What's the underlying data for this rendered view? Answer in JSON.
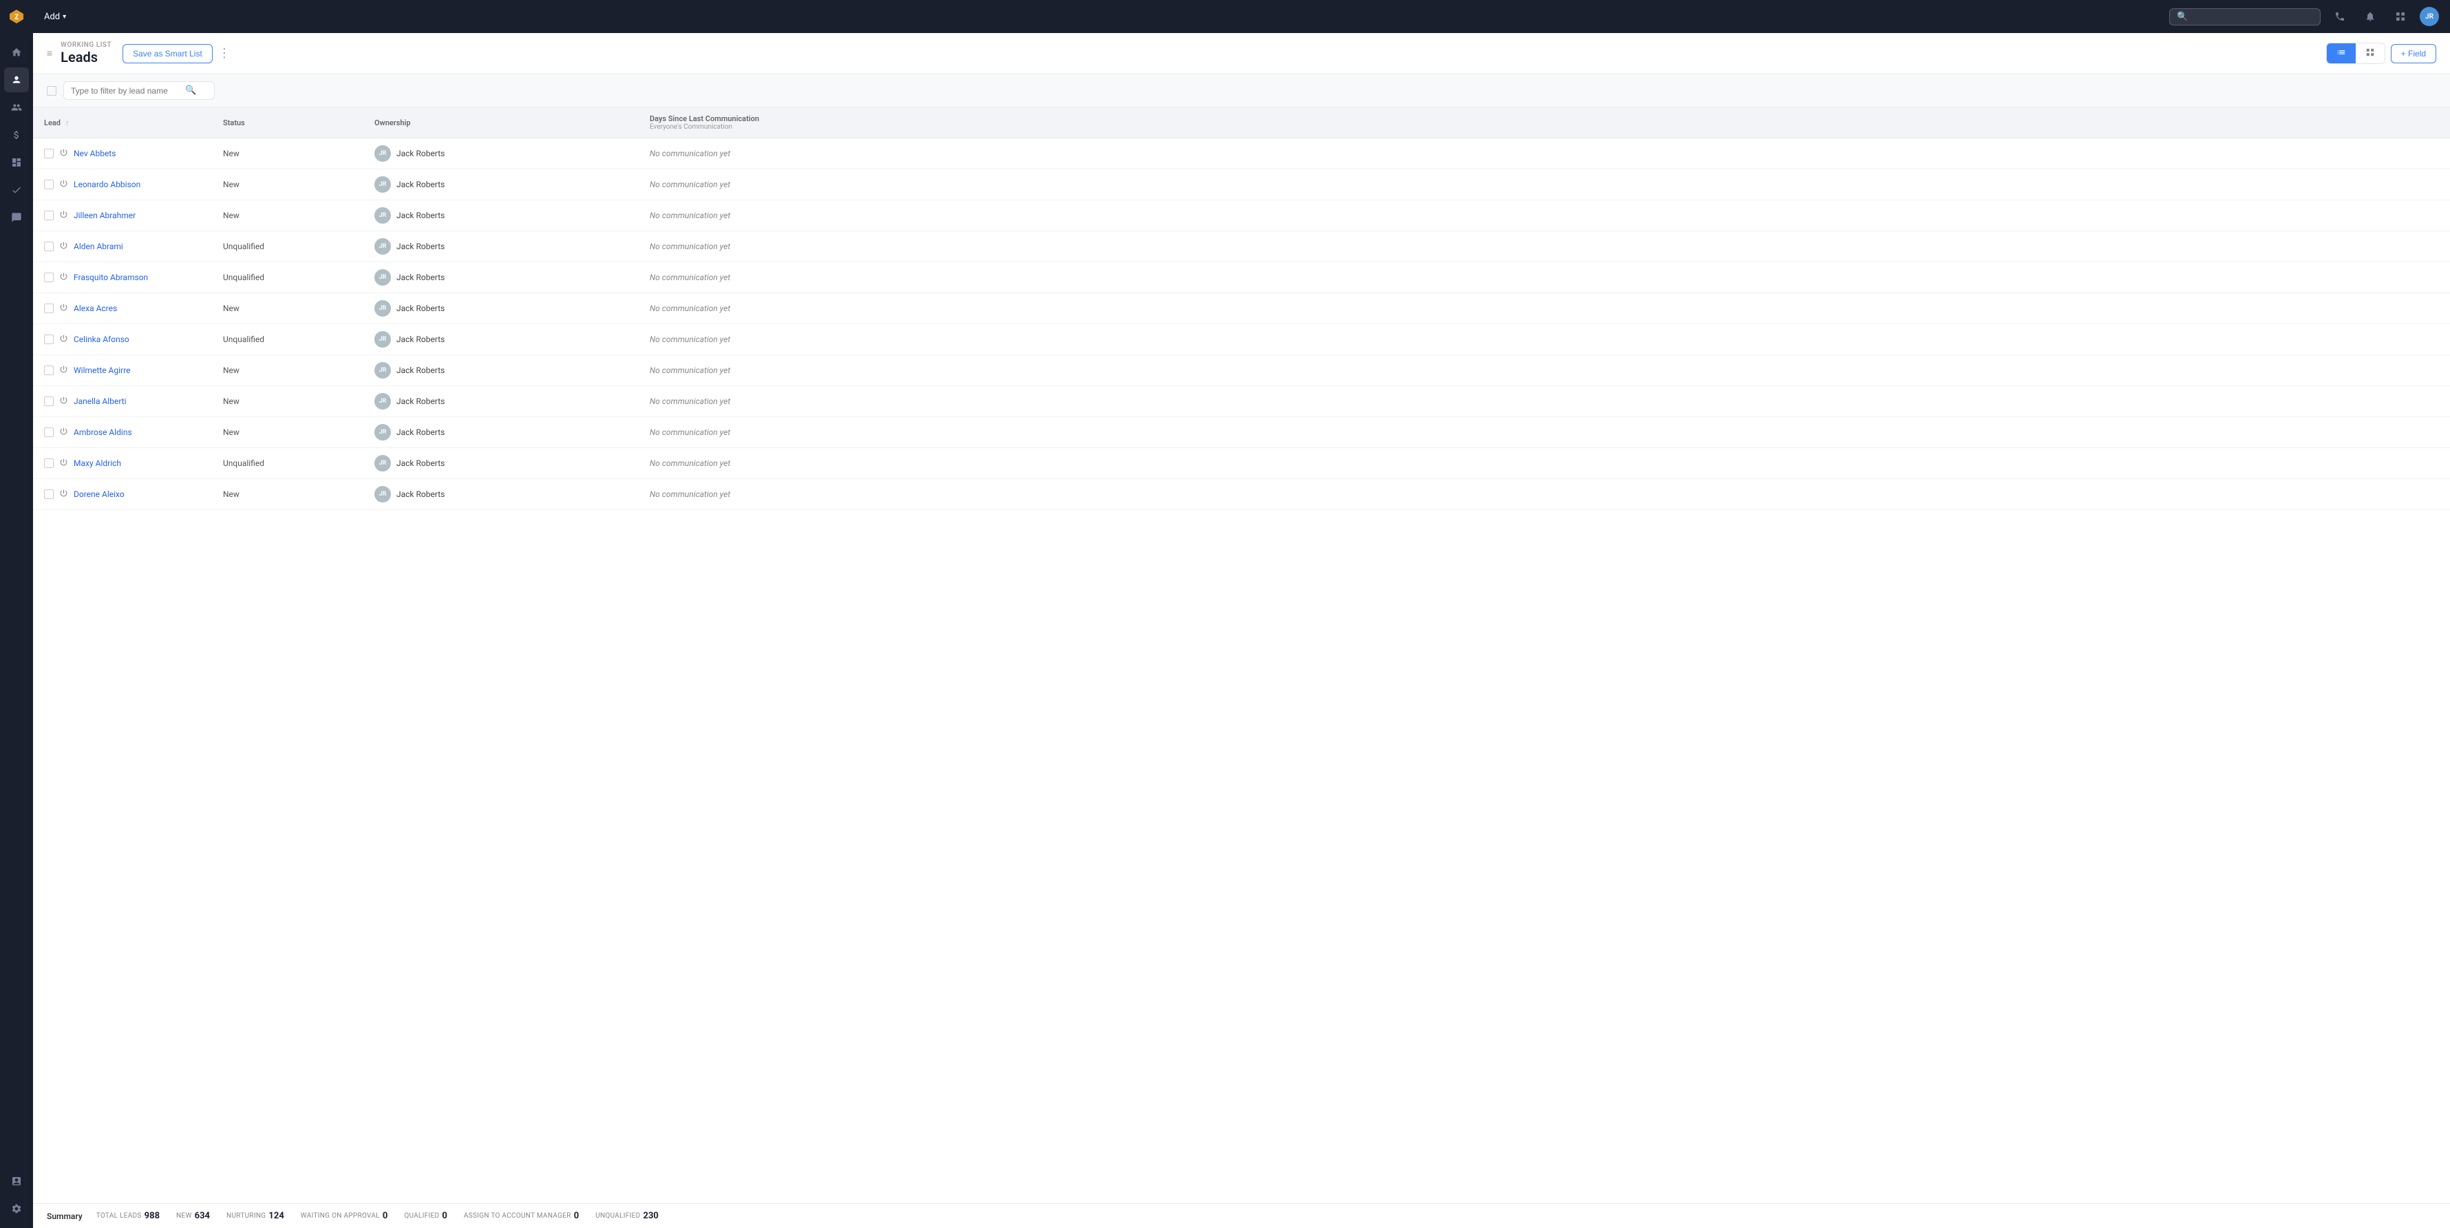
{
  "app": {
    "title": "Leads",
    "add_label": "Add",
    "logo_text": "Z"
  },
  "topbar": {
    "add_button": "Add",
    "search_placeholder": "",
    "user_initials": "JR"
  },
  "header": {
    "breadcrumb": "WORKING LIST",
    "title": "Leads",
    "save_smart_list": "Save as Smart List",
    "add_field": "+ Field"
  },
  "filter": {
    "search_placeholder": "Type to filter by lead name"
  },
  "table": {
    "columns": [
      {
        "id": "lead",
        "label": "Lead",
        "sortable": true
      },
      {
        "id": "status",
        "label": "Status",
        "sortable": false
      },
      {
        "id": "ownership",
        "label": "Ownership",
        "sortable": false
      },
      {
        "id": "comm",
        "label": "Days Since Last Communication",
        "sub": "Everyone's Communication",
        "sortable": false
      }
    ],
    "rows": [
      {
        "name": "Nev Abbets",
        "status": "New",
        "owner": "Jack Roberts",
        "owner_initials": "JR",
        "comm": "No communication yet"
      },
      {
        "name": "Leonardo Abbison",
        "status": "New",
        "owner": "Jack Roberts",
        "owner_initials": "JR",
        "comm": "No communication yet"
      },
      {
        "name": "Jilleen Abrahmer",
        "status": "New",
        "owner": "Jack Roberts",
        "owner_initials": "JR",
        "comm": "No communication yet"
      },
      {
        "name": "Alden Abrami",
        "status": "Unqualified",
        "owner": "Jack Roberts",
        "owner_initials": "JR",
        "comm": "No communication yet"
      },
      {
        "name": "Frasquito Abramson",
        "status": "Unqualified",
        "owner": "Jack Roberts",
        "owner_initials": "JR",
        "comm": "No communication yet"
      },
      {
        "name": "Alexa Acres",
        "status": "New",
        "owner": "Jack Roberts",
        "owner_initials": "JR",
        "comm": "No communication yet"
      },
      {
        "name": "Celinka Afonso",
        "status": "Unqualified",
        "owner": "Jack Roberts",
        "owner_initials": "JR",
        "comm": "No communication yet"
      },
      {
        "name": "Wilmette Agirre",
        "status": "New",
        "owner": "Jack Roberts",
        "owner_initials": "JR",
        "comm": "No communication yet"
      },
      {
        "name": "Janella Alberti",
        "status": "New",
        "owner": "Jack Roberts",
        "owner_initials": "JR",
        "comm": "No communication yet"
      },
      {
        "name": "Ambrose Aldins",
        "status": "New",
        "owner": "Jack Roberts",
        "owner_initials": "JR",
        "comm": "No communication yet"
      },
      {
        "name": "Maxy Aldrich",
        "status": "Unqualified",
        "owner": "Jack Roberts",
        "owner_initials": "JR",
        "comm": "No communication yet"
      },
      {
        "name": "Dorene Aleixo",
        "status": "New",
        "owner": "Jack Roberts",
        "owner_initials": "JR",
        "comm": "No communication yet"
      }
    ]
  },
  "summary": {
    "label": "Summary",
    "total_leads_label": "TOTAL LEADS",
    "total_leads_value": "988",
    "new_label": "NEW",
    "new_value": "634",
    "nurturing_label": "NURTURING",
    "nurturing_value": "124",
    "waiting_label": "WAITING ON APPROVAL",
    "waiting_value": "0",
    "qualified_label": "QUALIFIED",
    "qualified_value": "0",
    "assign_label": "ASSIGN TO ACCOUNT MANAGER",
    "assign_value": "0",
    "unqualified_label": "UNQUALIFIED",
    "unqualified_value": "230"
  },
  "sidebar": {
    "items": [
      {
        "icon": "⚡",
        "name": "flash",
        "active": false
      },
      {
        "icon": "🏠",
        "name": "home",
        "active": false
      },
      {
        "icon": "◎",
        "name": "leads",
        "active": true
      },
      {
        "icon": "👤",
        "name": "contacts",
        "active": false
      },
      {
        "icon": "$",
        "name": "deals",
        "active": false
      },
      {
        "icon": "📊",
        "name": "dashboard",
        "active": false
      },
      {
        "icon": "✓",
        "name": "tasks",
        "active": false
      },
      {
        "icon": "💬",
        "name": "messages",
        "active": false
      },
      {
        "icon": "📈",
        "name": "reports",
        "active": false
      },
      {
        "icon": "⚙",
        "name": "settings",
        "active": false
      }
    ]
  }
}
